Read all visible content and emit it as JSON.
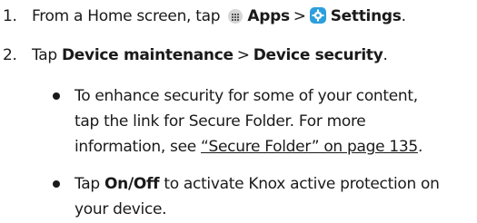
{
  "steps": [
    {
      "number": "1.",
      "prefix": "From a Home screen, tap",
      "apps_label": "Apps",
      "separator": ">",
      "settings_label": "Settings",
      "suffix": ".",
      "apps_icon": "apps-grid-icon",
      "settings_icon": "settings-gear-icon"
    },
    {
      "number": "2.",
      "prefix": "Tap",
      "item1": "Device maintenance",
      "separator": ">",
      "item2": "Device security",
      "suffix": "."
    }
  ],
  "bullets": [
    {
      "line1": "To enhance security for some of your content,",
      "line2": "tap the link for Secure Folder. For more",
      "line3_prefix": "information, see",
      "link": "“Secure Folder” on page 135",
      "line3_suffix": "."
    },
    {
      "prefix": "Tap",
      "bold": "On/Off",
      "line1_rest": "to activate Knox active protection on",
      "line2": "your device."
    }
  ]
}
